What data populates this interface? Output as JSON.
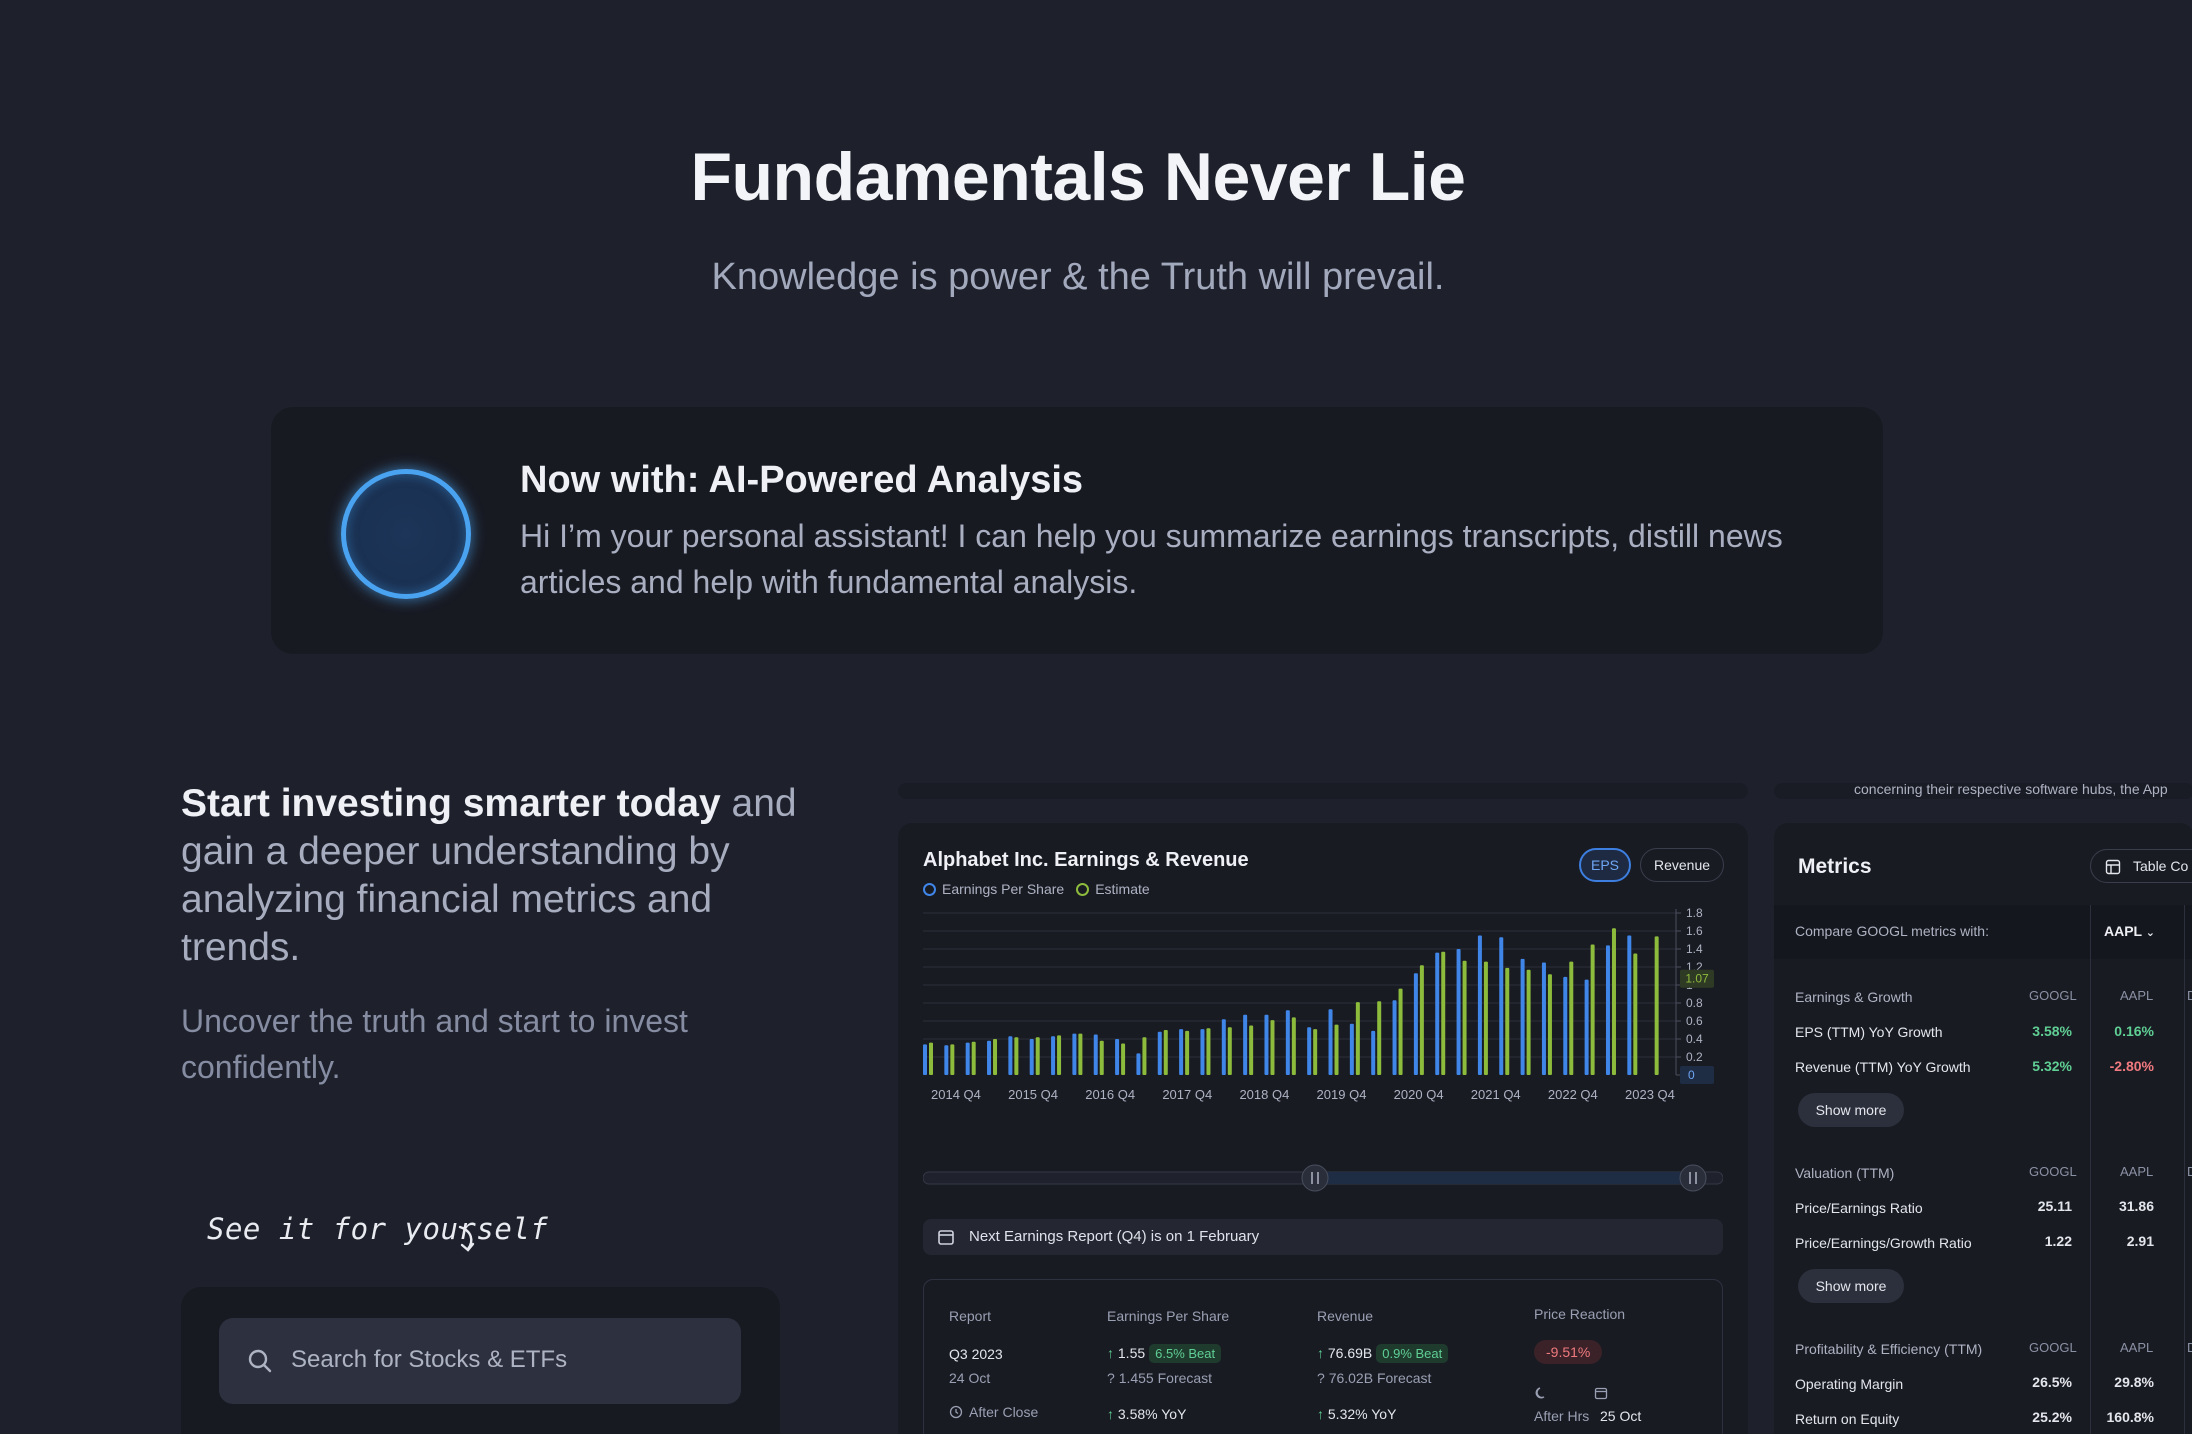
{
  "hero": {
    "title": "Fundamentals Never Lie",
    "subtitle": "Knowledge is power & the Truth will prevail."
  },
  "ai_banner": {
    "title": "Now with: AI-Powered Analysis",
    "text": "Hi I’m your personal assistant! I can help you summarize earnings transcripts, distill news articles and help with fundamental analysis."
  },
  "intro": {
    "lead_strong": "Start investing smarter today",
    "lead_rest": " and gain a deeper understanding by analyzing financial metrics and trends.",
    "sublead": "Uncover the truth and start to invest confidently.",
    "see_it": "See it for yourself",
    "search_placeholder": "Search for Stocks & ETFs"
  },
  "top_strip_text": "concerning their respective software hubs, the App",
  "earnings_panel": {
    "title": "Alphabet Inc. Earnings & Revenue",
    "legend": [
      "Earnings Per Share",
      "Estimate"
    ],
    "toggle": {
      "eps": "EPS",
      "revenue": "Revenue"
    },
    "next_report": "Next Earnings Report (Q4) is on 1 February",
    "report": {
      "headers": [
        "Report",
        "Earnings Per Share",
        "Revenue",
        "Price Reaction"
      ],
      "quarter": "Q3 2023",
      "date": "24 Oct",
      "timing": "After Close",
      "eps_actual": "1.55",
      "eps_beat": "6.5% Beat",
      "eps_forecast": "1.455 Forecast",
      "eps_yoy": "3.58% YoY",
      "rev_actual": "76.69B",
      "rev_beat": "0.9% Beat",
      "rev_forecast": "76.02B Forecast",
      "rev_yoy": "5.32% YoY",
      "price_reaction": "-9.51%",
      "after_hrs": "After Hrs",
      "reaction_date": "25 Oct"
    }
  },
  "chart_data": {
    "type": "bar",
    "title": "Alphabet Inc. Earnings & Revenue",
    "xlabel": "",
    "ylabel": "",
    "ylim": [
      0,
      1.8
    ],
    "y_ticks": [
      0,
      0.2,
      0.4,
      0.6,
      0.8,
      1.0,
      1.2,
      1.4,
      1.6,
      1.8
    ],
    "current_marker": "1.07",
    "zero_marker": "0",
    "x_tick_labels": [
      "2014 Q4",
      "2015 Q4",
      "2016 Q4",
      "2017 Q4",
      "2018 Q4",
      "2019 Q4",
      "2020 Q4",
      "2021 Q4",
      "2022 Q4",
      "2023 Q4"
    ],
    "series": [
      {
        "name": "Earnings Per Share",
        "color": "#3f86e8",
        "values": [
          0.34,
          0.33,
          0.36,
          0.38,
          0.43,
          0.4,
          0.43,
          0.46,
          0.45,
          0.4,
          0.24,
          0.48,
          0.51,
          0.51,
          0.62,
          0.67,
          0.67,
          0.72,
          0.53,
          0.73,
          0.57,
          0.49,
          0.83,
          1.13,
          1.36,
          1.4,
          1.55,
          1.53,
          1.29,
          1.25,
          1.09,
          1.06,
          1.44,
          1.55
        ]
      },
      {
        "name": "Estimate",
        "color": "#8dbb3c",
        "values": [
          0.36,
          0.34,
          0.37,
          0.4,
          0.42,
          0.42,
          0.44,
          0.46,
          0.38,
          0.35,
          0.42,
          0.5,
          0.49,
          0.52,
          0.53,
          0.55,
          0.61,
          0.64,
          0.51,
          0.56,
          0.81,
          0.82,
          0.96,
          1.22,
          1.37,
          1.27,
          1.26,
          1.19,
          1.17,
          1.12,
          1.26,
          1.45,
          1.63,
          1.35,
          1.54
        ]
      }
    ]
  },
  "metrics_panel": {
    "title": "Metrics",
    "table_button": "Table Co",
    "compare_label": "Compare GOOGL metrics with:",
    "compare_select": "AAPL",
    "col_a": "GOOGL",
    "col_b": "AAPL",
    "col_c": "D",
    "show_more": "Show more",
    "sections": [
      {
        "name": "Earnings & Growth",
        "rows": [
          {
            "label": "EPS (TTM) YoY Growth",
            "a": "3.58%",
            "b": "0.16%",
            "a_tone": "pos",
            "b_tone": "pos"
          },
          {
            "label": "Revenue (TTM) YoY Growth",
            "a": "5.32%",
            "b": "-2.80%",
            "a_tone": "pos",
            "b_tone": "neg"
          }
        ]
      },
      {
        "name": "Valuation (TTM)",
        "rows": [
          {
            "label": "Price/Earnings Ratio",
            "a": "25.11",
            "b": "31.86"
          },
          {
            "label": "Price/Earnings/Growth Ratio",
            "a": "1.22",
            "b": "2.91"
          }
        ]
      },
      {
        "name": "Profitability & Efficiency (TTM)",
        "rows": [
          {
            "label": "Operating Margin",
            "a": "26.5%",
            "b": "29.8%"
          },
          {
            "label": "Return on Equity",
            "a": "25.2%",
            "b": "160.8%"
          }
        ]
      }
    ]
  }
}
